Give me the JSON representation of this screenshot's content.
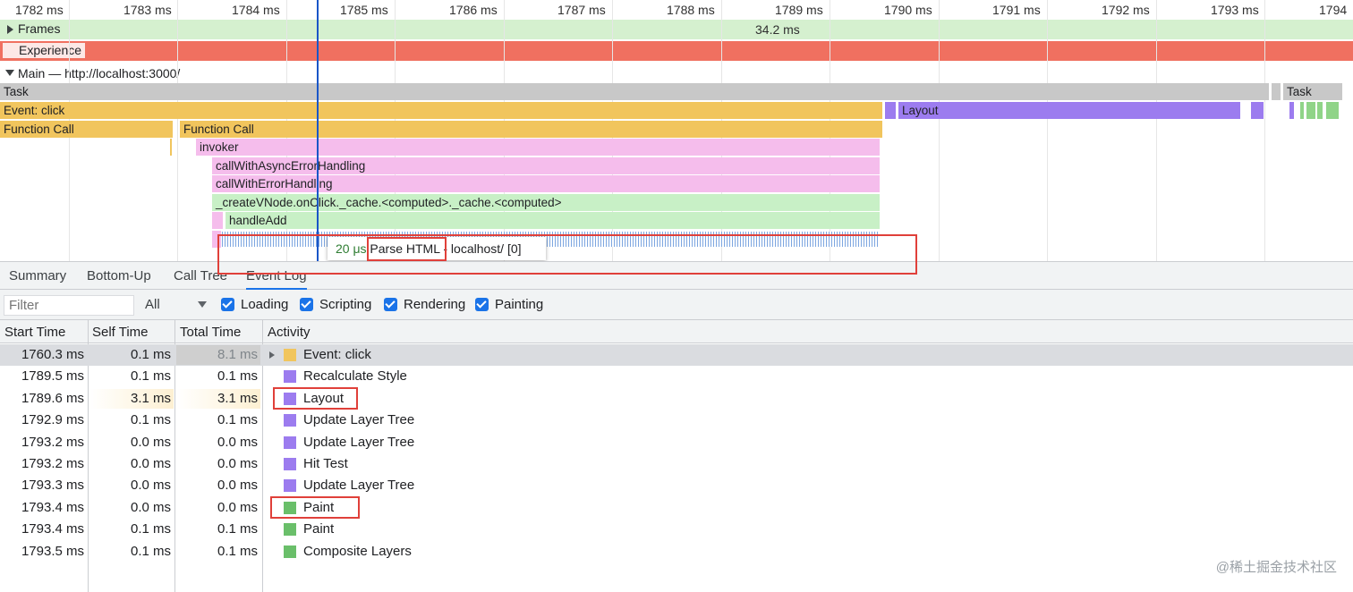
{
  "ruler": {
    "ticks": [
      "1782 ms",
      "1783 ms",
      "1784 ms",
      "1785 ms",
      "1786 ms",
      "1787 ms",
      "1788 ms",
      "1789 ms",
      "1790 ms",
      "1791 ms",
      "1792 ms",
      "1793 ms",
      "1794"
    ]
  },
  "tracks": {
    "frames": {
      "label": "Frames",
      "duration": "34.2 ms"
    },
    "experience": {
      "label": "Experience"
    },
    "main": {
      "label": "Main — http://localhost:3000/"
    }
  },
  "flame": {
    "task1": "Task",
    "task2": "Task",
    "event_click": "Event: click",
    "layout": "Layout",
    "function_call_1": "Function Call",
    "function_call_2": "Function Call",
    "invoker": "invoker",
    "call_async": "callWithAsyncErrorHandling",
    "call_error": "callWithErrorHandling",
    "create_vnode": "_createVNode.onClick._cache.<computed>._cache.<computed>",
    "handle_add": "handleAdd"
  },
  "tooltip": {
    "time": "20 μs",
    "name": "Parse HTML",
    "detail": " - localhost/ [0]"
  },
  "tabs": [
    "Summary",
    "Bottom-Up",
    "Call Tree",
    "Event Log"
  ],
  "filterbar": {
    "filter_placeholder": "Filter",
    "select_value": "All",
    "checkboxes": [
      "Loading",
      "Scripting",
      "Rendering",
      "Painting"
    ]
  },
  "table": {
    "headers": [
      "Start Time",
      "Self Time",
      "Total Time",
      "Activity"
    ],
    "rows": [
      {
        "start": "1760.3 ms",
        "self": "0.1 ms",
        "total": "8.1 ms",
        "activity": "Event: click",
        "color": "#f1c55d"
      },
      {
        "start": "1789.5 ms",
        "self": "0.1 ms",
        "total": "0.1 ms",
        "activity": "Recalculate Style",
        "color": "#9c7cef"
      },
      {
        "start": "1789.6 ms",
        "self": "3.1 ms",
        "total": "3.1 ms",
        "activity": "Layout",
        "color": "#9c7cef"
      },
      {
        "start": "1792.9 ms",
        "self": "0.1 ms",
        "total": "0.1 ms",
        "activity": "Update Layer Tree",
        "color": "#9c7cef"
      },
      {
        "start": "1793.2 ms",
        "self": "0.0 ms",
        "total": "0.0 ms",
        "activity": "Update Layer Tree",
        "color": "#9c7cef"
      },
      {
        "start": "1793.2 ms",
        "self": "0.0 ms",
        "total": "0.0 ms",
        "activity": "Hit Test",
        "color": "#9c7cef"
      },
      {
        "start": "1793.3 ms",
        "self": "0.0 ms",
        "total": "0.0 ms",
        "activity": "Update Layer Tree",
        "color": "#9c7cef"
      },
      {
        "start": "1793.4 ms",
        "self": "0.0 ms",
        "total": "0.0 ms",
        "activity": "Paint",
        "color": "#6abf6a"
      },
      {
        "start": "1793.4 ms",
        "self": "0.1 ms",
        "total": "0.1 ms",
        "activity": "Paint",
        "color": "#6abf6a"
      },
      {
        "start": "1793.5 ms",
        "self": "0.1 ms",
        "total": "0.1 ms",
        "activity": "Composite Layers",
        "color": "#6abf6a"
      }
    ]
  },
  "watermark": "@稀土掘金技术社区"
}
